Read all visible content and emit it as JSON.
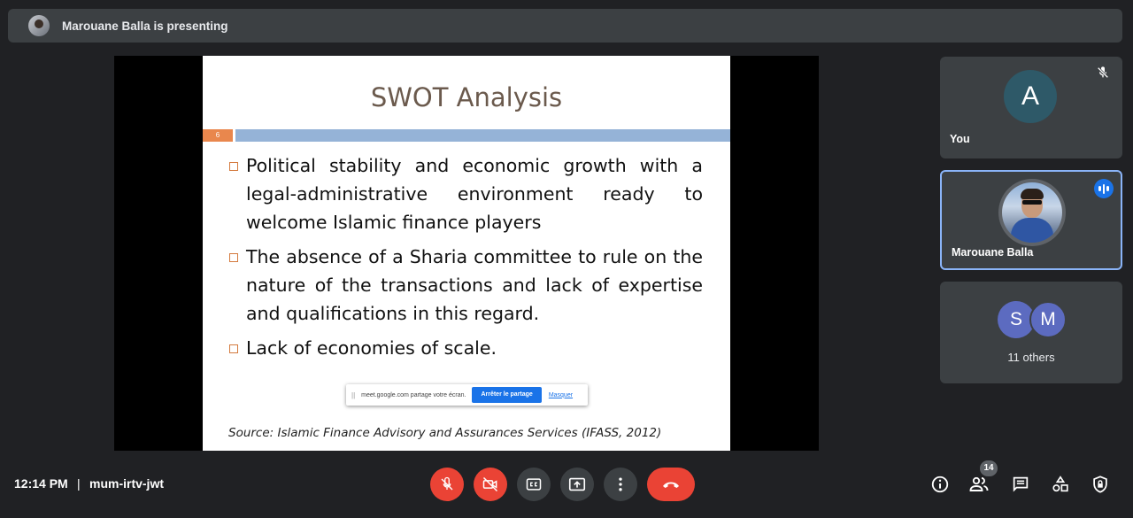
{
  "topbar": {
    "presenter_text": "Marouane Balla is presenting"
  },
  "slide": {
    "title": "SWOT Analysis",
    "slide_number": "6",
    "bullets": [
      "Political stability and economic growth with a legal-administrative environment ready to welcome Islamic finance players",
      "The absence of a Sharia committee to rule on the nature of the transactions and lack of expertise and qualifications in this regard.",
      "Lack of economies of scale."
    ],
    "source": "Source: Islamic Finance Advisory and Assurances Services (IFASS, 2012)"
  },
  "share_bar": {
    "grip": "||",
    "text": "meet.google.com partage votre écran.",
    "stop_label": "Arrêter le partage",
    "hide_label": "Masquer"
  },
  "participants": {
    "you": {
      "initial": "A",
      "name": "You",
      "avatar_color": "#2e5968"
    },
    "presenter": {
      "name": "Marouane Balla"
    },
    "others": {
      "initials": [
        "S",
        "M"
      ],
      "label": "11 others",
      "avatar_color": "#5c6bc0"
    }
  },
  "footer": {
    "time": "12:14 PM",
    "separator": "|",
    "meeting_code": "mum-irtv-jwt",
    "participant_count": "14"
  },
  "colors": {
    "background": "#202124",
    "surface": "#3c4043",
    "red": "#ea4335",
    "accent_blue": "#1a73e8",
    "highlight_border": "#8ab4f8"
  }
}
